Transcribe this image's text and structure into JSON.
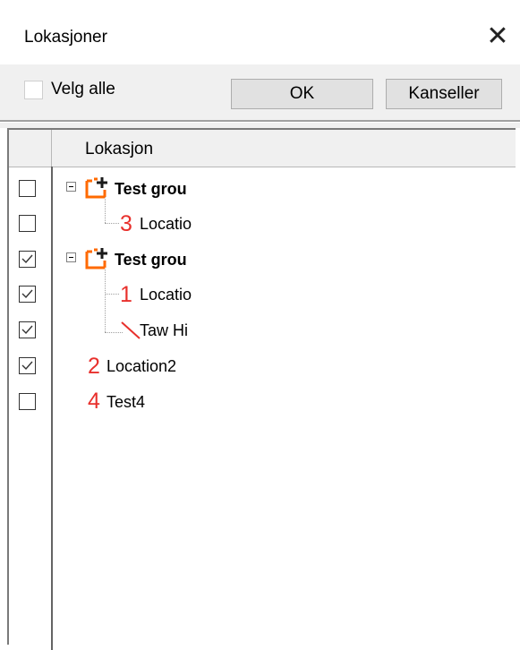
{
  "window": {
    "title": "Lokasjoner"
  },
  "toolbar": {
    "select_all_label": "Velg alle",
    "ok_label": "OK",
    "cancel_label": "Kanseller"
  },
  "grid": {
    "column_header": "Lokasjon",
    "rows": [
      {
        "label": "Test grou",
        "type": "group",
        "checked": false,
        "marker": ""
      },
      {
        "label": "Locatio",
        "type": "child",
        "checked": false,
        "marker": "3"
      },
      {
        "label": "Test grou",
        "type": "group",
        "checked": true,
        "marker": ""
      },
      {
        "label": "Locatio",
        "type": "child",
        "checked": true,
        "marker": "1"
      },
      {
        "label": "Taw Hi",
        "type": "child",
        "checked": true,
        "marker": "line"
      },
      {
        "label": "Location2",
        "type": "root",
        "checked": true,
        "marker": "2"
      },
      {
        "label": "Test4",
        "type": "root",
        "checked": false,
        "marker": "4"
      }
    ]
  },
  "colors": {
    "marker_red": "#e8302c",
    "group_icon_orange": "#ff6a00",
    "button_bg": "#e1e1e1"
  },
  "icons": [
    "close-icon",
    "group-add-icon",
    "checkbox-checked-icon",
    "tree-collapse-icon"
  ]
}
